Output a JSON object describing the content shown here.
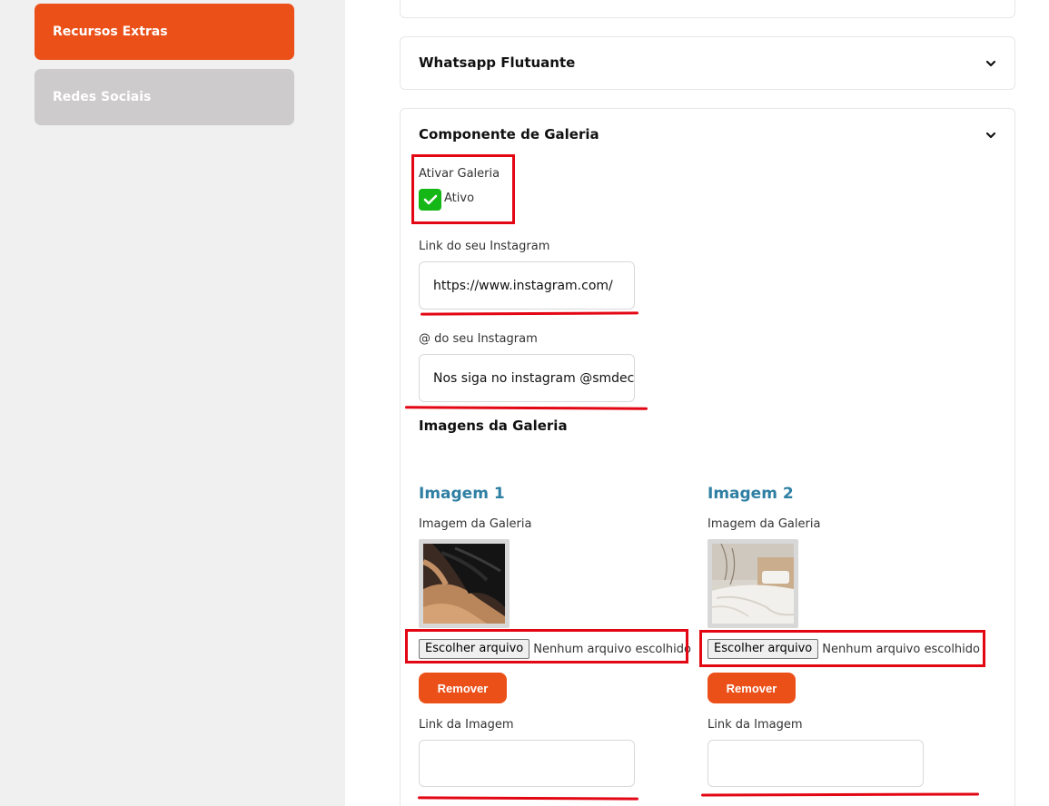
{
  "sidebar": {
    "items": [
      {
        "label": "Recursos Extras",
        "active": true
      },
      {
        "label": "Redes Sociais",
        "active": false
      }
    ]
  },
  "sections": {
    "whatsapp": {
      "title": "Whatsapp Flutuante",
      "icon": "chevron-down-icon"
    },
    "gallery": {
      "title": "Componente de Galeria",
      "icon": "chevron-down-icon",
      "activate_label": "Ativar Galeria",
      "activate_status": "Ativo",
      "instagram_link_label": "Link do seu Instagram",
      "instagram_link_value": "https://www.instagram.com/",
      "instagram_handle_label": "@ do seu Instagram",
      "instagram_handle_value": "Nos siga no instagram @smdeco",
      "images_heading": "Imagens da Galeria",
      "images": [
        {
          "title": "Imagem 1",
          "image_label": "Imagem da Galeria",
          "file_button": "Escolher arquivo",
          "file_status": "Nenhum arquivo escolhido",
          "remove_button": "Remover",
          "link_label": "Link da Imagem",
          "link_value": ""
        },
        {
          "title": "Imagem 2",
          "image_label": "Imagem da Galeria",
          "file_button": "Escolher arquivo",
          "file_status": "Nenhum arquivo escolhido",
          "remove_button": "Remover",
          "link_label": "Link da Imagem",
          "link_value": ""
        }
      ]
    }
  },
  "colors": {
    "accent": "#eb5019",
    "inactive": "#cdcbcc",
    "check": "#14b716",
    "annotation": "#e30613",
    "image_title": "#2e7fa3"
  }
}
